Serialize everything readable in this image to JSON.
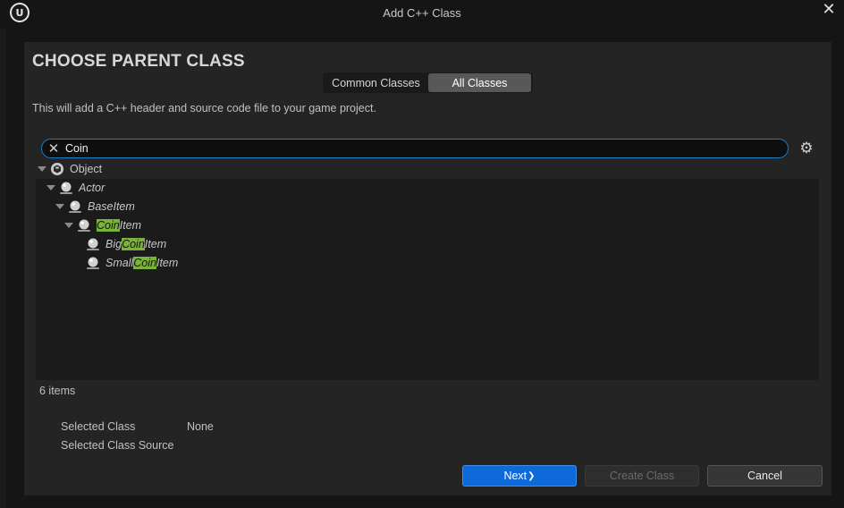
{
  "window": {
    "title": "Add C++ Class",
    "close_glyph": "✕",
    "logo_glyph": "U"
  },
  "dialog": {
    "heading": "CHOOSE PARENT CLASS",
    "tabs": [
      {
        "label": "Common Classes",
        "active": false
      },
      {
        "label": "All Classes",
        "active": true
      }
    ],
    "description": "This will add a C++ header and source code file to your game project."
  },
  "search": {
    "value": "Coin",
    "clear_glyph": "✕",
    "settings_glyph": "⚙"
  },
  "tree": [
    {
      "pre": "Object",
      "match": "",
      "post": "",
      "icon": "object-class-icon",
      "italic": false,
      "expanded": true
    },
    {
      "pre": "Actor",
      "match": "",
      "post": "",
      "icon": "actor-class-icon",
      "italic": true,
      "expanded": true
    },
    {
      "pre": "BaseItem",
      "match": "",
      "post": "",
      "icon": "actor-class-icon",
      "italic": true,
      "expanded": true
    },
    {
      "pre": "",
      "match": "Coin",
      "post": "Item",
      "icon": "actor-class-icon",
      "italic": true,
      "expanded": true
    },
    {
      "pre": "Big",
      "match": "Coin",
      "post": "Item",
      "icon": "actor-class-icon",
      "italic": true,
      "expanded": false
    },
    {
      "pre": "Small",
      "match": "Coin",
      "post": "Item",
      "icon": "actor-class-icon",
      "italic": true,
      "expanded": false
    }
  ],
  "status": {
    "count": "6 items"
  },
  "selection": {
    "class_label": "Selected Class",
    "class_value": "None",
    "source_label": "Selected Class Source",
    "source_value": ""
  },
  "buttons": {
    "next": "Next",
    "next_glyph": "❯",
    "create": "Create Class",
    "cancel": "Cancel"
  },
  "colors": {
    "accent": "#0e6ad8",
    "highlight": "#7ab339",
    "focus_border": "#1a7fc6"
  }
}
